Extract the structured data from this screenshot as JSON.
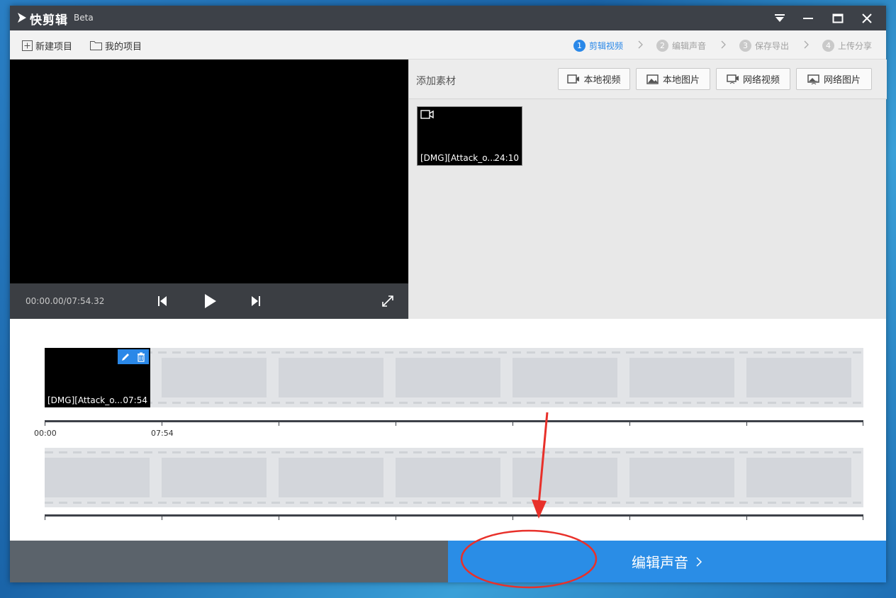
{
  "app": {
    "name": "快剪辑",
    "badge": "Beta"
  },
  "toolbar": {
    "new_project": "新建项目",
    "my_projects": "我的项目",
    "steps": [
      {
        "num": "1",
        "label": "剪辑视频"
      },
      {
        "num": "2",
        "label": "编辑声音"
      },
      {
        "num": "3",
        "label": "保存导出"
      },
      {
        "num": "4",
        "label": "上传分享"
      }
    ]
  },
  "player": {
    "time": "00:00.00/07:54.32"
  },
  "material": {
    "title": "添加素材",
    "buttons": [
      "本地视频",
      "本地图片",
      "网络视频",
      "网络图片"
    ],
    "item": {
      "name": "[DMG][Attack_o...",
      "duration": "24:10"
    }
  },
  "timeline": {
    "clip": {
      "name": "[DMG][Attack_o...",
      "duration": "07:54"
    },
    "ticks": [
      "00:00",
      "07:54"
    ]
  },
  "bottom": {
    "next_label": "编辑声音"
  },
  "colors": {
    "accent": "#2a88e8",
    "annotation": "#e8302a"
  }
}
